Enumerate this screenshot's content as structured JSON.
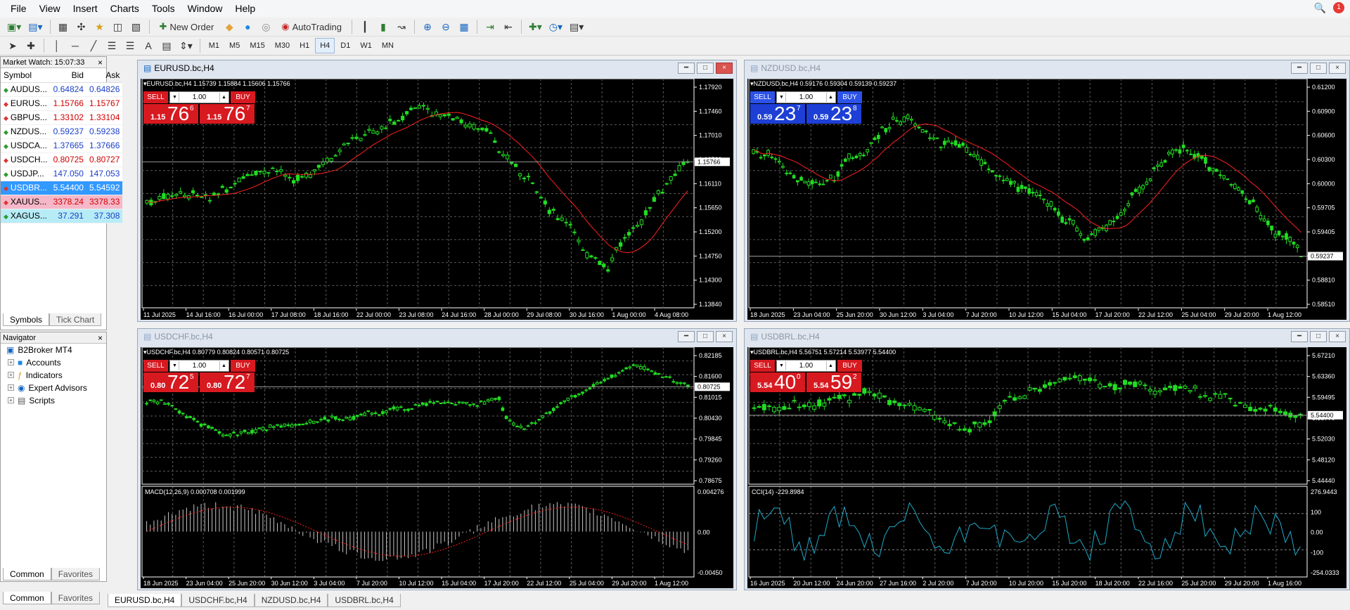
{
  "menu": [
    "File",
    "View",
    "Insert",
    "Charts",
    "Tools",
    "Window",
    "Help"
  ],
  "toolbar": {
    "new_order": "New Order",
    "autotrading": "AutoTrading"
  },
  "timeframes": [
    "M1",
    "M5",
    "M15",
    "M30",
    "H1",
    "H4",
    "D1",
    "W1",
    "MN"
  ],
  "active_timeframe": "H4",
  "market_watch": {
    "title": "Market Watch: 15:07:33",
    "headers": [
      "Symbol",
      "Bid",
      "Ask"
    ],
    "rows": [
      {
        "symbol": "AUDUS...",
        "bid": "0.64824",
        "ask": "0.64826",
        "dir": "up",
        "style": "blue"
      },
      {
        "symbol": "EURUS...",
        "bid": "1.15766",
        "ask": "1.15767",
        "dir": "down",
        "style": "red"
      },
      {
        "symbol": "GBPUS...",
        "bid": "1.33102",
        "ask": "1.33104",
        "dir": "down",
        "style": "red"
      },
      {
        "symbol": "NZDUS...",
        "bid": "0.59237",
        "ask": "0.59238",
        "dir": "up",
        "style": "blue"
      },
      {
        "symbol": "USDCA...",
        "bid": "1.37665",
        "ask": "1.37666",
        "dir": "up",
        "style": "blue"
      },
      {
        "symbol": "USDCH...",
        "bid": "0.80725",
        "ask": "0.80727",
        "dir": "down",
        "style": "red"
      },
      {
        "symbol": "USDJP...",
        "bid": "147.050",
        "ask": "147.053",
        "dir": "up",
        "style": "blue"
      },
      {
        "symbol": "USDBR...",
        "bid": "5.54400",
        "ask": "5.54592",
        "dir": "down",
        "style": "selected"
      },
      {
        "symbol": "XAUUS...",
        "bid": "3378.24",
        "ask": "3378.33",
        "dir": "down",
        "style": "pink"
      },
      {
        "symbol": "XAGUS...",
        "bid": "37.291",
        "ask": "37.308",
        "dir": "up",
        "style": "cyan"
      }
    ],
    "tabs": [
      "Symbols",
      "Tick Chart"
    ]
  },
  "navigator": {
    "title": "Navigator",
    "root": "B2Broker MT4",
    "items": [
      "Accounts",
      "Indicators",
      "Expert Advisors",
      "Scripts"
    ],
    "tabs": [
      "Common",
      "Favorites"
    ]
  },
  "outer_tabs": [
    "Common",
    "Favorites"
  ],
  "chart_tabs": [
    "EURUSD.bc,H4",
    "USDCHF.bc,H4",
    "NZDUSD.bc,H4",
    "USDBRL.bc,H4"
  ],
  "charts": {
    "eurusd": {
      "title": "EURUSD.bc,H4",
      "header": "EURUSD.bc,H4  1.15739 1.15884 1.15606 1.15766",
      "trade": {
        "sell": "SELL",
        "buy": "BUY",
        "lot": "1.00",
        "sell_small": "1.15",
        "sell_big": "76",
        "sell_sup": "6",
        "buy_small": "1.15",
        "buy_big": "76",
        "buy_sup": "7"
      },
      "price_labels": [
        "1.17920",
        "1.17460",
        "1.17010",
        "1.16560",
        "1.16110",
        "1.15650",
        "1.15200",
        "1.14750",
        "1.14300",
        "1.13840"
      ],
      "current_price": "1.15766",
      "time_labels": [
        "11 Jul 2025",
        "14 Jul 16:00",
        "16 Jul 00:00",
        "17 Jul 08:00",
        "18 Jul 16:00",
        "22 Jul 00:00",
        "23 Jul 08:00",
        "24 Jul 16:00",
        "28 Jul 00:00",
        "29 Jul 08:00",
        "30 Jul 16:00",
        "1 Aug 00:00",
        "4 Aug 08:00"
      ]
    },
    "nzdusd": {
      "title": "NZDUSD.bc,H4",
      "header": "NZDUSD.bc,H4  0.59176 0.59304 0.59139 0.59237",
      "trade": {
        "sell": "SELL",
        "buy": "BUY",
        "lot": "1.00",
        "sell_small": "0.59",
        "sell_big": "23",
        "sell_sup": "7",
        "buy_small": "0.59",
        "buy_big": "23",
        "buy_sup": "8"
      },
      "price_labels": [
        "0.61200",
        "0.60900",
        "0.60600",
        "0.60300",
        "0.60000",
        "0.59705",
        "0.59405",
        "0.59110",
        "0.58810",
        "0.58510"
      ],
      "current_price": "0.59237",
      "time_labels": [
        "18 Jun 2025",
        "23 Jun 04:00",
        "25 Jun 20:00",
        "30 Jun 12:00",
        "3 Jul 04:00",
        "7 Jul 20:00",
        "10 Jul 12:00",
        "15 Jul 04:00",
        "17 Jul 20:00",
        "22 Jul 12:00",
        "25 Jul 04:00",
        "29 Jul 20:00",
        "1 Aug 12:00"
      ]
    },
    "usdchf": {
      "title": "USDCHF.bc,H4",
      "header": "USDCHF.bc,H4  0.80779 0.80824 0.80571 0.80725",
      "trade": {
        "sell": "SELL",
        "buy": "BUY",
        "lot": "1.00",
        "sell_small": "0.80",
        "sell_big": "72",
        "sell_sup": "5",
        "buy_small": "0.80",
        "buy_big": "72",
        "buy_sup": "7"
      },
      "price_labels": [
        "0.82185",
        "0.81600",
        "0.81015",
        "0.80430",
        "0.79845",
        "0.79260",
        "0.78675"
      ],
      "current_price": "0.80725",
      "indicator": "MACD(12,26,9) 0.000708 0.001999",
      "indicator_labels": [
        "0.004276",
        "0.00",
        "-0.00450"
      ],
      "time_labels": [
        "18 Jun 2025",
        "23 Jun 04:00",
        "25 Jun 20:00",
        "30 Jun 12:00",
        "3 Jul 04:00",
        "7 Jul 20:00",
        "10 Jul 12:00",
        "15 Jul 04:00",
        "17 Jul 20:00",
        "22 Jul 12:00",
        "25 Jul 04:00",
        "29 Jul 20:00",
        "1 Aug 12:00"
      ]
    },
    "usdbrl": {
      "title": "USDBRL.bc,H4",
      "header": "USDBRL.bc,H4  5.56751 5.57214 5.53977 5.54400",
      "trade": {
        "sell": "SELL",
        "buy": "BUY",
        "lot": "1.00",
        "sell_small": "5.54",
        "sell_big": "40",
        "sell_sup": "0",
        "buy_small": "5.54",
        "buy_big": "59",
        "buy_sup": "2"
      },
      "price_labels": [
        "5.67210",
        "5.63360",
        "5.59495",
        "5.55770",
        "5.52030",
        "5.48120",
        "5.44440"
      ],
      "current_price": "5.54400",
      "indicator": "CCI(14) -229.8984",
      "indicator_labels": [
        "276.9443",
        "100",
        "0.00",
        "-100",
        "-254.0333"
      ],
      "time_labels": [
        "16 Jun 2025",
        "20 Jun 12:00",
        "24 Jun 20:00",
        "27 Jun 16:00",
        "2 Jul 20:00",
        "7 Jul 20:00",
        "10 Jul 20:00",
        "15 Jul 20:00",
        "18 Jul 20:00",
        "22 Jul 16:00",
        "25 Jul 20:00",
        "29 Jul 20:00",
        "1 Aug 16:00"
      ]
    }
  }
}
